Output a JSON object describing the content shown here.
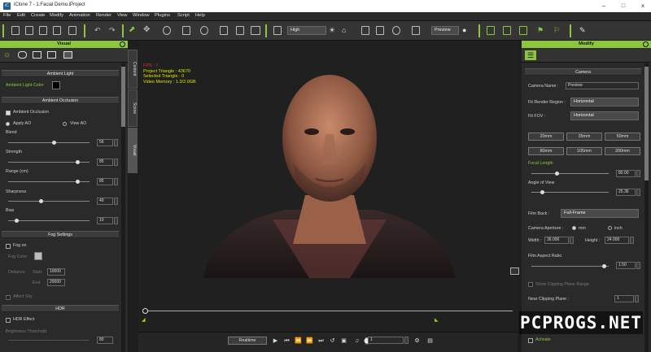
{
  "window": {
    "title": "iClone 7 - 1.Facial Demo.iProject",
    "app_icon": "iclone-logo-icon"
  },
  "menu": [
    "File",
    "Edit",
    "Create",
    "Modify",
    "Animation",
    "Render",
    "View",
    "Window",
    "Plugins",
    "Script",
    "Help"
  ],
  "toolbar": {
    "quality": "High",
    "preview": "Preview"
  },
  "left_panel": {
    "title": "Visual",
    "ambient_light": {
      "header": "Ambient Light",
      "color_label": "Ambient Light Color"
    },
    "ambient_occlusion": {
      "header": "Ambient Occlusion",
      "enable_label": "Ambient Occlusion",
      "apply_label": "Apply AO",
      "view_label": "View AO",
      "blend_label": "Blend",
      "blend_value": "56",
      "blend": 56,
      "strength_label": "Strength",
      "strength_value": "85",
      "strength": 85,
      "range_label": "Range (cm)",
      "range_value": "85",
      "range": 85,
      "sharpness_label": "Sharpness",
      "sharpness_value": "40",
      "sharpness": 40,
      "bias_label": "Bias",
      "bias_value": "10",
      "bias": 10
    },
    "fog": {
      "header": "Fog Settings",
      "enable_label": "Fog on",
      "color_label": "Fog Color",
      "distance_label": "Distance",
      "start_label": "Start",
      "start_value": "10000",
      "end_label": "End",
      "end_value": "20000",
      "affect_label": "Affect Sky"
    },
    "hdr": {
      "header": "HDR",
      "effect_label": "HDR Effect",
      "threshold_label": "Brightness Threshold",
      "threshold_value": "80"
    }
  },
  "side_tabs": [
    "Content",
    "Scene",
    "Visual"
  ],
  "viewport": {
    "fps": "FPS : 7",
    "triangles": "Project Triangle : 43670",
    "selected": "Selected Triangle : 0",
    "video_memory": "Video Memory : 1.3/2.0GB"
  },
  "playback": {
    "mode": "Realtime",
    "frame": "1"
  },
  "right_panel": {
    "title": "Modify",
    "camera": {
      "header": "Camera",
      "name_label": "Camera Name :",
      "name_value": "Preview",
      "fit_region_label": "Fit Render Region :",
      "fit_region_value": "Horizontal",
      "fit_fov_label": "Fit FOV :",
      "fit_fov_value": "Horizontal",
      "lens_buttons": [
        "20mm",
        "35mm",
        "50mm",
        "80mm",
        "105mm",
        "200mm"
      ],
      "focal_label": "Focal Length",
      "focal_value": "80.00",
      "focal": 80,
      "aov_label": "Angle of View",
      "aov_value": "25.36",
      "aov": 25.36,
      "film_back_label": "Film Back :",
      "film_back_value": "Full-Frame",
      "aperture_label": "Camera Aperture :",
      "mm_label": "mm",
      "inch_label": "inch",
      "width_label": "Width :",
      "width_value": "36.000",
      "height_label": "Height :",
      "height_value": "24.000",
      "aspect_label": "Film Aspect Ratio",
      "aspect_value": "1.50",
      "aspect": 1.5,
      "clipping_label": "Show Clipping Plane Range",
      "near_label": "Near Clipping Plane :",
      "near_value": "1",
      "activate_label": "Activate"
    }
  },
  "watermark": "PCPROGS.NET",
  "colors": {
    "accent": "#8cc63f",
    "panel": "#2a2a2a",
    "viewport": "#202020"
  }
}
